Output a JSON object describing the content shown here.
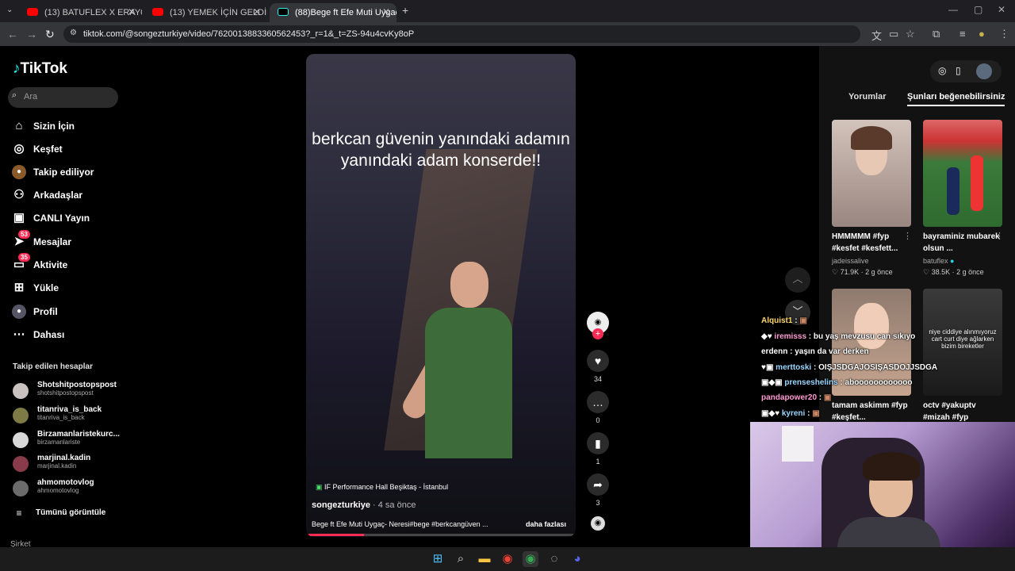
{
  "browser": {
    "tabs": [
      {
        "title": "(13) BATUFLEX X ERAY067 & M",
        "favicon": "youtube-icon",
        "active": false
      },
      {
        "title": "(13) YEMEK İÇİN GELDİK, EVE A",
        "favicon": "youtube-icon",
        "active": false
      },
      {
        "title": "(88)Bege ft Efe Muti Uygaç- Ne",
        "favicon": "tiktok-icon",
        "active": true
      }
    ],
    "url": "tiktok.com/@songezturkiye/video/7620013883360562453?_r=1&_t=ZS-94u4cvKy8oP"
  },
  "sidebar": {
    "logo": "TikTok",
    "search_placeholder": "Ara",
    "nav": [
      {
        "label": "Sizin İçin",
        "icon": "home-icon"
      },
      {
        "label": "Keşfet",
        "icon": "compass-icon"
      },
      {
        "label": "Takip ediliyor",
        "icon": "following-icon"
      },
      {
        "label": "Arkadaşlar",
        "icon": "friends-icon"
      },
      {
        "label": "CANLI Yayın",
        "icon": "live-icon"
      },
      {
        "label": "Mesajlar",
        "icon": "messages-icon",
        "badge": "53"
      },
      {
        "label": "Aktivite",
        "icon": "activity-icon",
        "badge": "35"
      },
      {
        "label": "Yükle",
        "icon": "upload-icon"
      },
      {
        "label": "Profil",
        "icon": "profile-icon"
      },
      {
        "label": "Dahası",
        "icon": "more-icon"
      }
    ],
    "following_title": "Takip edilen hesaplar",
    "following": [
      {
        "name": "Shotshitpostopspost",
        "handle": "shotshitpostopspost"
      },
      {
        "name": "titanriva_is_back",
        "handle": "titanriva_is_back"
      },
      {
        "name": "Birzamanlaristekurc...",
        "handle": "birzamanlariste"
      },
      {
        "name": "marjinal.kadin",
        "handle": "marjinal.kadin"
      },
      {
        "name": "ahmomotovlog",
        "handle": "ahmomotovlog"
      }
    ],
    "see_all": "Tümünü görüntüle",
    "footer": "Şirket"
  },
  "video": {
    "caption": "berkcan güvenin yanındaki adamın yanındaki adam konserde!!",
    "location": "IF Performance Hall Beşiktaş - İstanbul",
    "author": "songezturkiye",
    "time": "· 4 sa önce",
    "description": "Bege ft Efe Muti Uygaç- Neresi#bege #berkcangüven ...",
    "more": "daha fazlası",
    "progress": 0.21
  },
  "actions": {
    "likes": "34",
    "comments": "0",
    "saves": "1",
    "shares": "3"
  },
  "right_panel": {
    "tabs": [
      "Yorumlar",
      "Şunları beğenebilirsiniz"
    ],
    "cards": [
      {
        "title": "HMMMMM #fyp #kesfet #kesfett...",
        "author": "jadeissalive",
        "likes": "71.9K",
        "time": "2 g önce"
      },
      {
        "title": "bayraminiz mubarek olsun ...",
        "author": "batuflex",
        "likes": "38.5K",
        "time": "2 g önce"
      },
      {
        "title": "tamam askimm #fyp #keşfet...",
        "author": "",
        "likes": "",
        "time": ""
      },
      {
        "title": "octv #yakuptv #mizah #fyp",
        "author": "",
        "likes": "",
        "time": ""
      }
    ],
    "card_overlay_text": "niye ciddiye alınmıyoruz cart curt diye ağlarken bizim bireketler"
  },
  "chat": [
    {
      "user": "Alquist1",
      "msg": ""
    },
    {
      "user": "iremisss",
      "msg": "bu yaş mevzusu can sıkıyo"
    },
    {
      "user": "erdenn",
      "msg": "yaşın da var derken"
    },
    {
      "user": "merttoski",
      "msg": "OIŞJSDGAJOSIŞASDOJJSDGA"
    },
    {
      "user": "prenseshelins",
      "msg": "aboooooooooooo"
    },
    {
      "user": "pandapower20",
      "msg": ""
    },
    {
      "user": "kyreni",
      "msg": ""
    }
  ],
  "colors": {
    "accent": "#fe2c55",
    "background": "#000000",
    "panel": "#121212"
  }
}
